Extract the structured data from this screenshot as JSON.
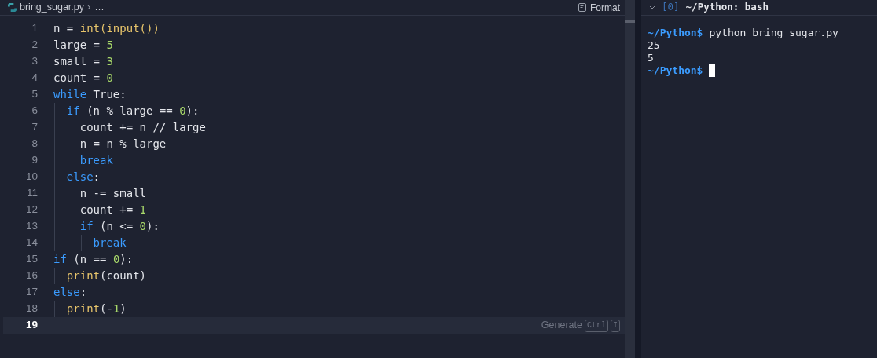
{
  "editor": {
    "breadcrumb": {
      "file": "bring_sugar.py",
      "separator": "›",
      "more": "…"
    },
    "format_button": "Format",
    "lines": [
      {
        "number": "1",
        "active": false,
        "tokens": [
          {
            "kind": "plain",
            "text": "n = "
          },
          {
            "kind": "func",
            "text": "int(input())"
          }
        ]
      },
      {
        "number": "2",
        "active": false,
        "tokens": [
          {
            "kind": "plain",
            "text": "large = "
          },
          {
            "kind": "num",
            "text": "5"
          }
        ]
      },
      {
        "number": "3",
        "active": false,
        "tokens": [
          {
            "kind": "plain",
            "text": "small = "
          },
          {
            "kind": "num",
            "text": "3"
          }
        ]
      },
      {
        "number": "4",
        "active": false,
        "tokens": [
          {
            "kind": "plain",
            "text": "count = "
          },
          {
            "kind": "num",
            "text": "0"
          }
        ]
      },
      {
        "number": "5",
        "active": false,
        "tokens": [
          {
            "kind": "kw",
            "text": "while "
          },
          {
            "kind": "plain",
            "text": "True:"
          }
        ]
      },
      {
        "number": "6",
        "active": false,
        "tokens": [
          {
            "kind": "kw",
            "text": "  if "
          },
          {
            "kind": "plain",
            "text": "(n % large == "
          },
          {
            "kind": "num",
            "text": "0"
          },
          {
            "kind": "plain",
            "text": "):"
          }
        ]
      },
      {
        "number": "7",
        "active": false,
        "tokens": [
          {
            "kind": "plain",
            "text": "    count += n // large"
          }
        ]
      },
      {
        "number": "8",
        "active": false,
        "tokens": [
          {
            "kind": "plain",
            "text": "    n = n % large"
          }
        ]
      },
      {
        "number": "9",
        "active": false,
        "tokens": [
          {
            "kind": "kw",
            "text": "    break"
          }
        ]
      },
      {
        "number": "10",
        "active": false,
        "tokens": [
          {
            "kind": "kw",
            "text": "  else"
          },
          {
            "kind": "plain",
            "text": ":"
          }
        ]
      },
      {
        "number": "11",
        "active": false,
        "tokens": [
          {
            "kind": "plain",
            "text": "    n -= small"
          }
        ]
      },
      {
        "number": "12",
        "active": false,
        "tokens": [
          {
            "kind": "plain",
            "text": "    count += "
          },
          {
            "kind": "num",
            "text": "1"
          }
        ]
      },
      {
        "number": "13",
        "active": false,
        "tokens": [
          {
            "kind": "kw",
            "text": "    if "
          },
          {
            "kind": "plain",
            "text": "(n <= "
          },
          {
            "kind": "num",
            "text": "0"
          },
          {
            "kind": "plain",
            "text": "):"
          }
        ]
      },
      {
        "number": "14",
        "active": false,
        "tokens": [
          {
            "kind": "kw",
            "text": "      break"
          }
        ]
      },
      {
        "number": "15",
        "active": false,
        "tokens": [
          {
            "kind": "kw",
            "text": "if "
          },
          {
            "kind": "plain",
            "text": "(n == "
          },
          {
            "kind": "num",
            "text": "0"
          },
          {
            "kind": "plain",
            "text": "):"
          }
        ]
      },
      {
        "number": "16",
        "active": false,
        "tokens": [
          {
            "kind": "func",
            "text": "  print"
          },
          {
            "kind": "plain",
            "text": "(count)"
          }
        ]
      },
      {
        "number": "17",
        "active": false,
        "tokens": [
          {
            "kind": "kw",
            "text": "else"
          },
          {
            "kind": "plain",
            "text": ":"
          }
        ]
      },
      {
        "number": "18",
        "active": false,
        "tokens": [
          {
            "kind": "func",
            "text": "  print"
          },
          {
            "kind": "plain",
            "text": "(-"
          },
          {
            "kind": "num",
            "text": "1"
          },
          {
            "kind": "plain",
            "text": ")"
          }
        ]
      },
      {
        "number": "19",
        "active": true
      }
    ],
    "inline_hint": {
      "text": "Generate",
      "keys": [
        "Ctrl",
        "I"
      ]
    }
  },
  "terminal": {
    "tab_index": "[0]",
    "title": "~/Python: bash",
    "lines": [
      {
        "kind": "prompt",
        "prompt": "~/Python$",
        "command": "python bring_sugar.py",
        "cursor": false
      },
      {
        "kind": "output",
        "text": "25"
      },
      {
        "kind": "output",
        "text": "5"
      },
      {
        "kind": "prompt",
        "prompt": "~/Python$",
        "cursor": true
      }
    ]
  }
}
